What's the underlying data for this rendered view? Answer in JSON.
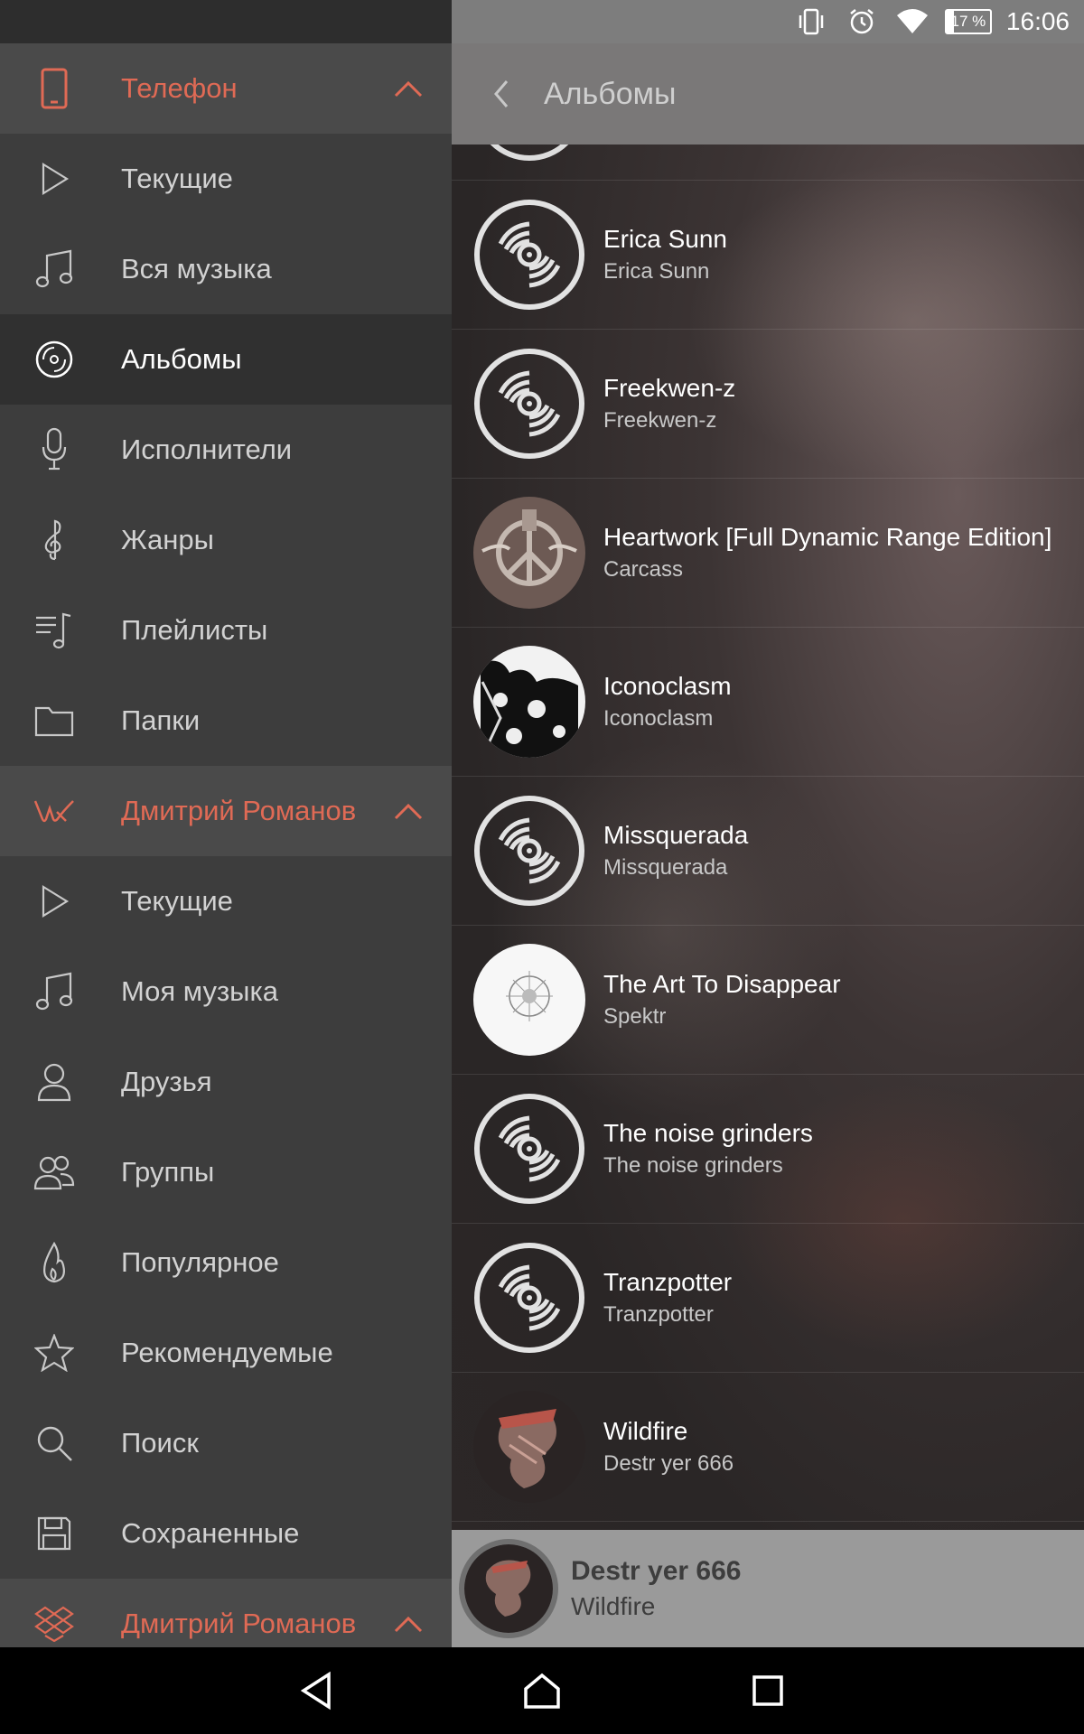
{
  "status_bar": {
    "time": "16:06",
    "battery": "17 %"
  },
  "toolbar": {
    "title": "Альбомы"
  },
  "drawer": {
    "phone_section": {
      "label": "Телефон",
      "color": "#e06a55"
    },
    "phone_items": [
      {
        "label": "Текущие",
        "icon": "play-icon"
      },
      {
        "label": "Вся музыка",
        "icon": "music-note-icon"
      },
      {
        "label": "Альбомы",
        "icon": "disc-icon",
        "selected": true
      },
      {
        "label": "Исполнители",
        "icon": "microphone-icon"
      },
      {
        "label": "Жанры",
        "icon": "treble-clef-icon"
      },
      {
        "label": "Плейлисты",
        "icon": "playlist-icon"
      },
      {
        "label": "Папки",
        "icon": "folder-icon"
      }
    ],
    "vk_section": {
      "label": "Дмитрий Романов"
    },
    "vk_items": [
      {
        "label": "Текущие",
        "icon": "play-icon"
      },
      {
        "label": "Моя музыка",
        "icon": "music-note-icon"
      },
      {
        "label": "Друзья",
        "icon": "person-icon"
      },
      {
        "label": "Группы",
        "icon": "group-icon"
      },
      {
        "label": "Популярное",
        "icon": "flame-icon"
      },
      {
        "label": "Рекомендуемые",
        "icon": "star-icon"
      },
      {
        "label": "Поиск",
        "icon": "search-icon"
      },
      {
        "label": "Сохраненные",
        "icon": "save-icon"
      }
    ],
    "dropbox_section": {
      "label": "Дмитрий Романов"
    }
  },
  "albums": [
    {
      "title": "Erica Sunn",
      "artist": "Erica Sunn",
      "cover": "placeholder"
    },
    {
      "title": "Freekwen-z",
      "artist": "Freekwen-z",
      "cover": "placeholder"
    },
    {
      "title": "Heartwork [Full Dynamic Range Edition]",
      "artist": "Carcass",
      "cover": "heartwork"
    },
    {
      "title": "Iconoclasm",
      "artist": "Iconoclasm",
      "cover": "iconoclasm"
    },
    {
      "title": "Missquerada",
      "artist": "Missquerada",
      "cover": "placeholder"
    },
    {
      "title": "The Art To Disappear",
      "artist": "Spektr",
      "cover": "white"
    },
    {
      "title": "The noise grinders",
      "artist": "The noise grinders",
      "cover": "placeholder"
    },
    {
      "title": "Tranzpotter",
      "artist": "Tranzpotter",
      "cover": "placeholder"
    },
    {
      "title": "Wildfire",
      "artist": "Destr yer 666",
      "cover": "wildfire"
    }
  ],
  "now_playing": {
    "artist": "Destr yer 666",
    "title": "Wildfire"
  },
  "colors": {
    "accent": "#e06a55",
    "drawer_bg": "#3d3d3d",
    "toolbar_bg": "#7a7878"
  }
}
